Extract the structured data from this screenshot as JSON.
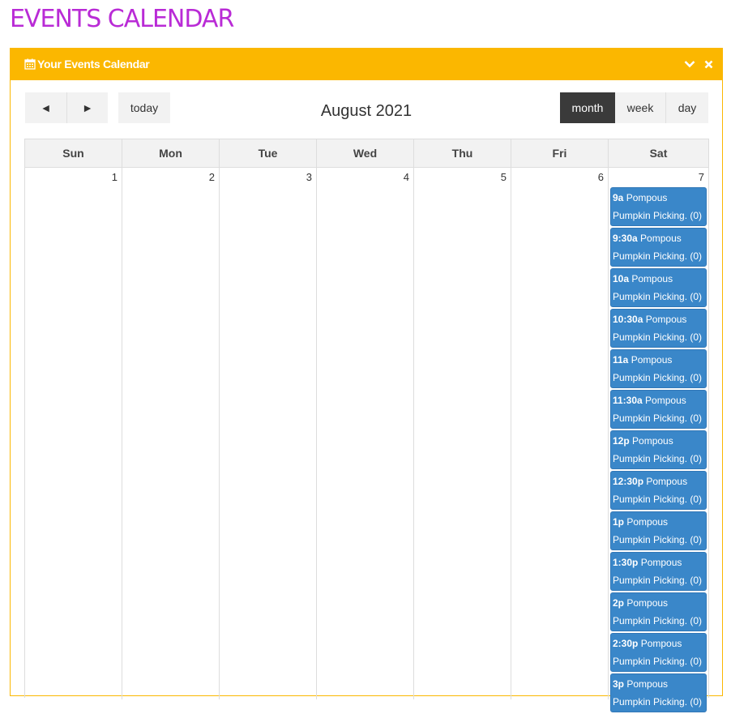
{
  "page": {
    "title": "EVENTS CALENDAR"
  },
  "panel": {
    "title": "Your Events Calendar",
    "icon": "calendar-icon",
    "accent": "#fbb700"
  },
  "toolbar": {
    "prev_label": "◄",
    "next_label": "►",
    "today_label": "today",
    "title": "August 2021",
    "views": [
      "month",
      "week",
      "day"
    ],
    "active_view": "month"
  },
  "calendar": {
    "weekdays": [
      "Sun",
      "Mon",
      "Tue",
      "Wed",
      "Thu",
      "Fri",
      "Sat"
    ],
    "days": [
      "1",
      "2",
      "3",
      "4",
      "5",
      "6",
      "7"
    ],
    "events_sat": [
      {
        "time": "9a",
        "title": "Pompous Pumpkin Picking. (0)"
      },
      {
        "time": "9:30a",
        "title": "Pompous Pumpkin Picking. (0)"
      },
      {
        "time": "10a",
        "title": "Pompous Pumpkin Picking. (0)"
      },
      {
        "time": "10:30a",
        "title": "Pompous Pumpkin Picking. (0)"
      },
      {
        "time": "11a",
        "title": "Pompous Pumpkin Picking. (0)"
      },
      {
        "time": "11:30a",
        "title": "Pompous Pumpkin Picking. (0)"
      },
      {
        "time": "12p",
        "title": "Pompous Pumpkin Picking. (0)"
      },
      {
        "time": "12:30p",
        "title": "Pompous Pumpkin Picking. (0)"
      },
      {
        "time": "1p",
        "title": "Pompous Pumpkin Picking. (0)"
      },
      {
        "time": "1:30p",
        "title": "Pompous Pumpkin Picking. (0)"
      },
      {
        "time": "2p",
        "title": "Pompous Pumpkin Picking. (0)"
      },
      {
        "time": "2:30p",
        "title": "Pompous Pumpkin Picking. (0)"
      },
      {
        "time": "3p",
        "title": "Pompous Pumpkin Picking. (0)"
      }
    ],
    "event_color": "#3a87c9"
  }
}
